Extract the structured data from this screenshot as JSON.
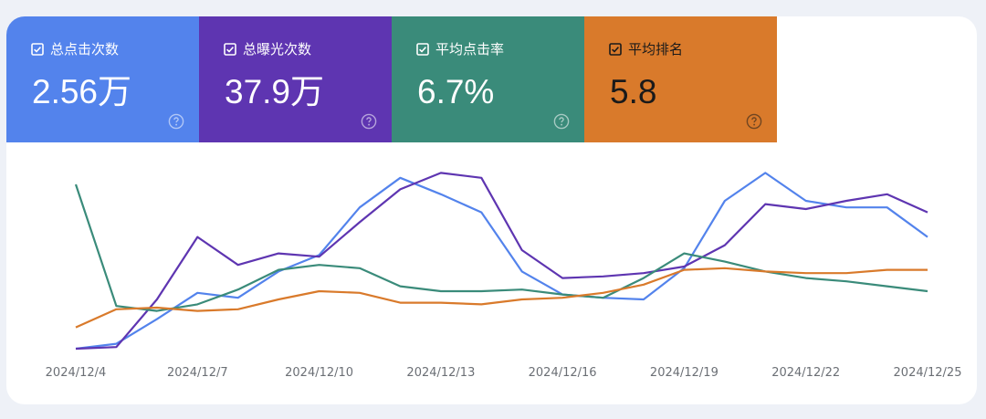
{
  "tiles": [
    {
      "label": "总点击次数",
      "value": "2.56万",
      "bg": "#5383ec",
      "fg": "#ffffff"
    },
    {
      "label": "总曝光次数",
      "value": "37.9万",
      "bg": "#5e35b1",
      "fg": "#ffffff"
    },
    {
      "label": "平均点击率",
      "value": "6.7%",
      "bg": "#3a8b7a",
      "fg": "#ffffff"
    },
    {
      "label": "平均排名",
      "value": "5.8",
      "bg": "#d97a2b",
      "fg": "#1a1a1a"
    }
  ],
  "chart_data": {
    "type": "line",
    "x": [
      "2024/12/4",
      "2024/12/5",
      "2024/12/6",
      "2024/12/7",
      "2024/12/8",
      "2024/12/9",
      "2024/12/10",
      "2024/12/11",
      "2024/12/12",
      "2024/12/13",
      "2024/12/14",
      "2024/12/15",
      "2024/12/16",
      "2024/12/17",
      "2024/12/18",
      "2024/12/19",
      "2024/12/20",
      "2024/12/21",
      "2024/12/22",
      "2024/12/23",
      "2024/12/24",
      "2024/12/25"
    ],
    "xticks": [
      "2024/12/4",
      "2024/12/7",
      "2024/12/10",
      "2024/12/13",
      "2024/12/16",
      "2024/12/19",
      "2024/12/22",
      "2024/12/25"
    ],
    "grid": false,
    "series": [
      {
        "color": "#5383ec",
        "values": [
          0,
          3,
          18,
          34,
          31,
          47,
          57,
          86,
          104,
          94,
          83,
          47,
          33,
          31,
          30,
          49,
          90,
          107,
          90,
          86,
          86,
          68
        ]
      },
      {
        "color": "#5e35b1",
        "values": [
          0,
          1,
          30,
          68,
          51,
          58,
          56,
          77,
          97,
          107,
          104,
          60,
          43,
          44,
          46,
          50,
          63,
          88,
          85,
          90,
          94,
          83
        ]
      },
      {
        "color": "#3a8b7a",
        "values": [
          100,
          26,
          23,
          27,
          36,
          48,
          51,
          49,
          38,
          35,
          35,
          36,
          33,
          31,
          43,
          58,
          53,
          47,
          43,
          41,
          38,
          35
        ]
      },
      {
        "color": "#d97a2b",
        "values": [
          13,
          24,
          25,
          23,
          24,
          30,
          35,
          34,
          28,
          28,
          27,
          30,
          31,
          34,
          39,
          48,
          49,
          47,
          46,
          46,
          48,
          48
        ]
      }
    ]
  }
}
